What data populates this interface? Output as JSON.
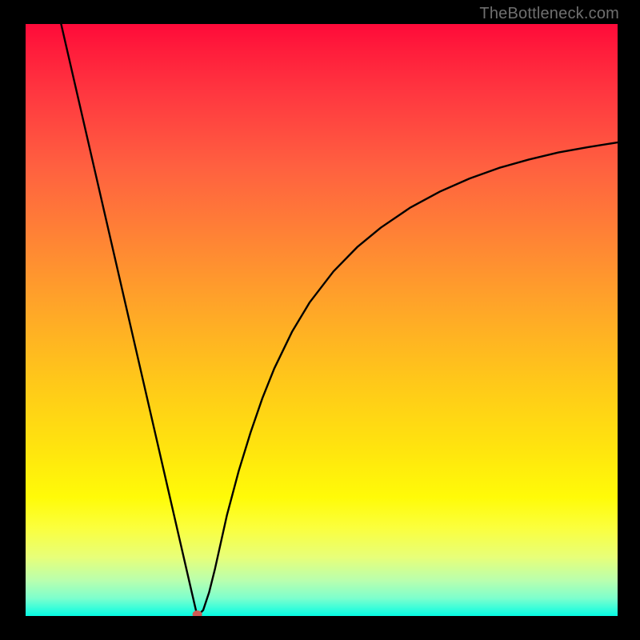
{
  "attribution": "TheBottleneck.com",
  "chart_data": {
    "type": "line",
    "title": "",
    "xlabel": "",
    "ylabel": "",
    "xlim": [
      0,
      100
    ],
    "ylim": [
      0,
      100
    ],
    "grid": false,
    "axes_visible": false,
    "gradient_stops": [
      {
        "pos": 0.0,
        "color": "#ff0a3a"
      },
      {
        "pos": 0.04,
        "color": "#ff1b3b"
      },
      {
        "pos": 0.12,
        "color": "#ff3840"
      },
      {
        "pos": 0.24,
        "color": "#ff6040"
      },
      {
        "pos": 0.36,
        "color": "#ff8335"
      },
      {
        "pos": 0.48,
        "color": "#ffa628"
      },
      {
        "pos": 0.6,
        "color": "#ffc71a"
      },
      {
        "pos": 0.72,
        "color": "#ffe50e"
      },
      {
        "pos": 0.8,
        "color": "#fffb08"
      },
      {
        "pos": 0.85,
        "color": "#fbff3c"
      },
      {
        "pos": 0.9,
        "color": "#e8ff78"
      },
      {
        "pos": 0.94,
        "color": "#b9ffae"
      },
      {
        "pos": 0.97,
        "color": "#7dffcd"
      },
      {
        "pos": 0.99,
        "color": "#2dfddc"
      },
      {
        "pos": 1.0,
        "color": "#07f9e3"
      }
    ],
    "series": [
      {
        "name": "bottleneck-curve",
        "color": "#000000",
        "x": [
          6,
          8,
          10,
          12,
          14,
          16,
          18,
          20,
          22,
          24,
          26,
          28,
          29,
          30,
          31,
          32,
          33,
          34,
          36,
          38,
          40,
          42,
          45,
          48,
          52,
          56,
          60,
          65,
          70,
          75,
          80,
          85,
          90,
          95,
          100
        ],
        "y": [
          100,
          91.3,
          82.6,
          73.9,
          65.2,
          56.5,
          47.8,
          39.1,
          30.4,
          21.7,
          13.0,
          4.3,
          0.0,
          1.0,
          4.0,
          8.0,
          12.5,
          17.0,
          24.5,
          31.0,
          36.8,
          41.8,
          48.0,
          53.0,
          58.2,
          62.3,
          65.6,
          69.0,
          71.7,
          73.9,
          75.7,
          77.1,
          78.3,
          79.2,
          80.0
        ]
      }
    ],
    "marker": {
      "name": "min-point",
      "x": 29,
      "y": 0,
      "color": "#cf5b55",
      "rx": 6,
      "ry": 5
    }
  }
}
